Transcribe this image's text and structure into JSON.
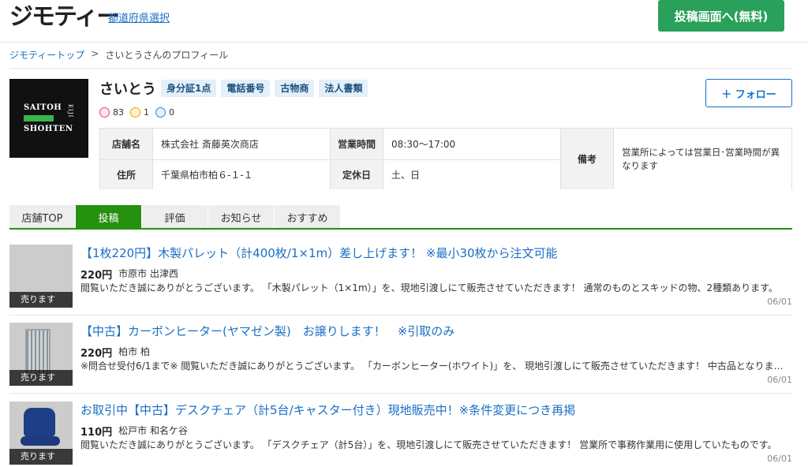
{
  "header": {
    "logo": "ジモティー",
    "pref_link": "都道府県選択",
    "post_button": "投稿画面へ(無料)"
  },
  "breadcrumb": {
    "top": "ジモティートップ",
    "sep": ">",
    "current": "さいとうさんのプロフィール"
  },
  "profile": {
    "logo_line1": "SAITOH",
    "logo_line2": "SHOHTEN",
    "logo_side": "EIJI",
    "name": "さいとう",
    "badges": [
      "身分証1点",
      "電話番号",
      "古物商",
      "法人書類"
    ],
    "ratings": {
      "good": "83",
      "ok": "1",
      "bad": "0"
    },
    "follow_button": "＋ フォロー"
  },
  "info": {
    "shop_label": "店舗名",
    "shop_value": "株式会社 斎藤英次商店",
    "hours_label": "営業時間",
    "hours_value": "08:30〜17:00",
    "address_label": "住所",
    "address_value": "千葉県柏市柏６-１-１",
    "closed_label": "定休日",
    "closed_value": "土、日",
    "note_label": "備考",
    "note_value": "営業所によっては営業日･営業時間が異なります"
  },
  "tabs": [
    {
      "label": "店舗TOP",
      "active": false
    },
    {
      "label": "投稿",
      "active": true
    },
    {
      "label": "評価",
      "active": false
    },
    {
      "label": "お知らせ",
      "active": false
    },
    {
      "label": "おすすめ",
      "active": false
    }
  ],
  "listings": [
    {
      "title": "【1枚220円】木製パレット（計400枚/1×1m）差し上げます！ ※最小30枚から注文可能",
      "price": "220円",
      "location": "市原市 出津西",
      "desc": "閲覧いただき誠にありがとうございます。 「木製パレット（1×1m）」を、現地引渡しにて販売させていただきます！ 通常のものとスキッドの物、2種類あります。",
      "date": "06/01",
      "tag": "売ります",
      "image": "pallet-photo"
    },
    {
      "title": "【中古】カーボンヒーター(ヤマゼン製)　お譲りします！　※引取のみ",
      "price": "220円",
      "location": "柏市 柏",
      "desc": "※問合せ受付6/1まで※ 閲覧いただき誠にありがとうございます。 「カーボンヒーター(ホワイト)」を、 現地引渡しにて販売させていただきます！ 中古品となります。",
      "date": "06/01",
      "tag": "売ります",
      "image": "heater-photo"
    },
    {
      "title": "お取引中【中古】デスクチェア（計5台/キャスター付き）現地販売中！※条件変更につき再掲",
      "price": "110円",
      "location": "松戸市 和名ケ谷",
      "desc": "閲覧いただき誠にありがとうございます。 「デスクチェア（計5台）」を、現地引渡しにて販売させていただきます！ 営業所で事務作業用に使用していたものです。",
      "date": "06/01",
      "tag": "売ります",
      "image": "chair-photo"
    }
  ],
  "colors": {
    "brand_green": "#2aa15a",
    "tab_green": "#26900f",
    "link_blue": "#1a6fc4",
    "badge_bg": "#e3f0fa"
  }
}
